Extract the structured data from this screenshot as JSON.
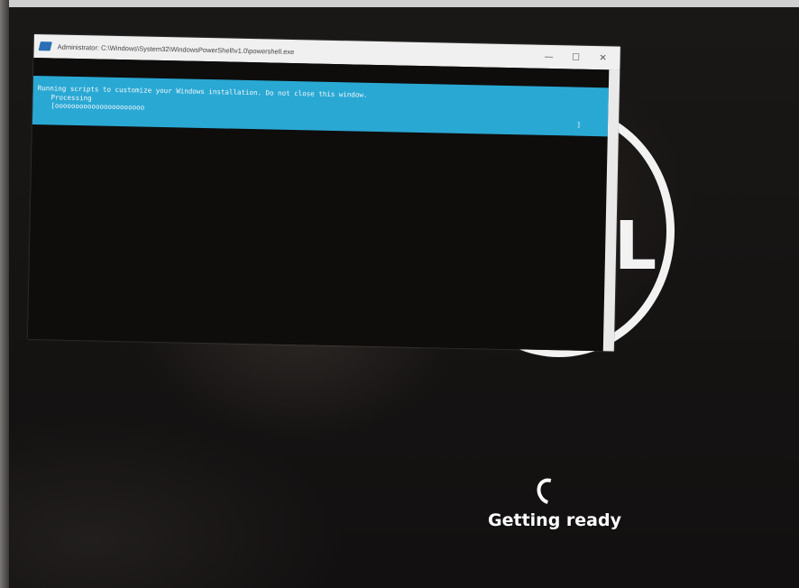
{
  "powershell_window": {
    "title": "Administrator: C:\\Windows\\System32\\WindowsPowerShell\\v1.0\\powershell.exe",
    "controls": {
      "minimize": "—",
      "maximize": "☐",
      "close": "✕"
    },
    "progress": {
      "activity": "Running scripts to customize your Windows installation. Do not close this window.",
      "status": "Processing",
      "bar": "[oooooooooooooooooooooo",
      "bar_end": "]"
    }
  },
  "setup": {
    "status_text": "Getting ready",
    "logo_letter": "L"
  },
  "icons": {
    "powershell": "powershell-icon",
    "spinner": "loading-spinner-icon",
    "logo": "dell-logo-icon"
  }
}
